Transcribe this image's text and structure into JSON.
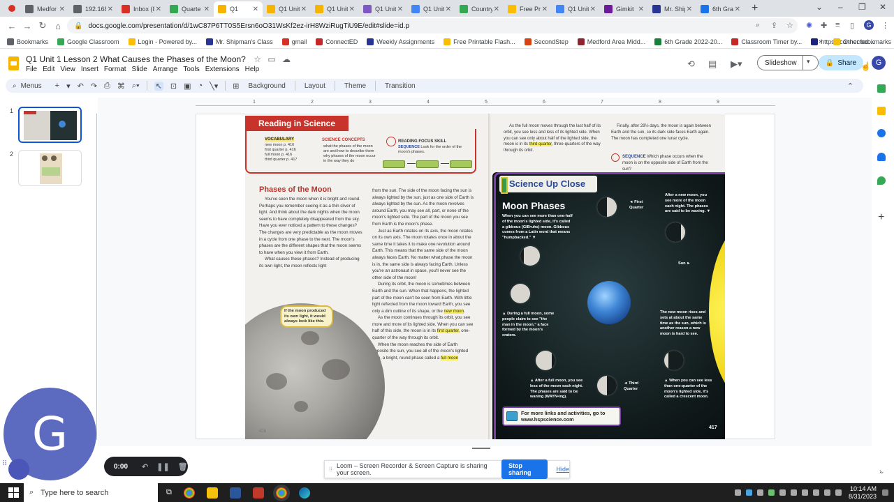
{
  "browser": {
    "tabs": [
      {
        "label": "Medfor",
        "color": "#5f6368"
      },
      {
        "label": "192.168",
        "color": "#5f6368"
      },
      {
        "label": "Inbox (8",
        "color": "#d93025"
      },
      {
        "label": "Quarte",
        "color": "#34a853"
      },
      {
        "label": "Q1",
        "color": "#f4b400",
        "active": true
      },
      {
        "label": "Q1 Unit",
        "color": "#f4b400"
      },
      {
        "label": "Q1 Unit",
        "color": "#f4b400"
      },
      {
        "label": "Q1 Unit",
        "color": "#7e57c2"
      },
      {
        "label": "Q1 Unit",
        "color": "#4285f4"
      },
      {
        "label": "Country",
        "color": "#34a853"
      },
      {
        "label": "Free Pri",
        "color": "#fbbc04"
      },
      {
        "label": "Q1 Unit",
        "color": "#4285f4"
      },
      {
        "label": "Gimkit",
        "color": "#6a1b9a"
      },
      {
        "label": "Mr. Ship",
        "color": "#283593"
      },
      {
        "label": "6th Gra",
        "color": "#1a73e8"
      }
    ],
    "url": "docs.google.com/presentation/d/1wC87P6TT0S5Ersn6oO31WsKf2ez-irH8WziRugTiU9E/edit#slide=id.p",
    "bookmarks": [
      {
        "label": "Bookmarks",
        "color": "#5f6368"
      },
      {
        "label": "Google Classroom",
        "color": "#34a853"
      },
      {
        "label": "Login - Powered by...",
        "color": "#fbbc04"
      },
      {
        "label": "Mr. Shipman's Class",
        "color": "#283593"
      },
      {
        "label": "gmail",
        "color": "#d93025"
      },
      {
        "label": "ConnectED",
        "color": "#c62828"
      },
      {
        "label": "Weekly Assignments",
        "color": "#283593"
      },
      {
        "label": "Free Printable Flash...",
        "color": "#fbbc04"
      },
      {
        "label": "SecondStep",
        "color": "#d84315"
      },
      {
        "label": "Medford Area Midd...",
        "color": "#8e2430"
      },
      {
        "label": "6th Grade 2022-20...",
        "color": "#188038"
      },
      {
        "label": "Classroom Timer by...",
        "color": "#c62828"
      },
      {
        "label": "https://connected....",
        "color": "#1a237e"
      }
    ],
    "other_bookmarks": "Other bookmarks"
  },
  "slides": {
    "title": "Q1 Unit 1 Lesson 2 What Causes the Phases of the Moon?",
    "menu": [
      "File",
      "Edit",
      "View",
      "Insert",
      "Format",
      "Slide",
      "Arrange",
      "Tools",
      "Extensions",
      "Help"
    ],
    "slideshow_label": "Slideshow",
    "share_label": "Share",
    "account_initial": "G",
    "toolbar": {
      "menus_label": "Menus",
      "background": "Background",
      "layout": "Layout",
      "theme": "Theme",
      "transition": "Transition"
    },
    "ruler_marks": [
      "1",
      "2",
      "3",
      "4",
      "5",
      "6",
      "7",
      "8",
      "9"
    ],
    "slide_numbers": [
      "1",
      "2"
    ]
  },
  "book": {
    "banner": "Reading in Science",
    "vocab_label": "VOCABULARY",
    "vocab_items": [
      "new moon p. 416",
      "first quarter p. 416",
      "full moon p. 416",
      "third quarter p. 417"
    ],
    "concepts_label": "SCIENCE CONCEPTS",
    "concepts": [
      "what the phases of the moon are and how to describe them",
      "why phases of the moon occur in the way they do"
    ],
    "focus_label": "READING FOCUS SKILL",
    "focus_skill": "SEQUENCE",
    "focus_text": "Look for the order of the moon's phases.",
    "phases_title": "Phases of the Moon",
    "col1a": "You've seen the moon when it is bright and round. Perhaps you remember seeing it as a thin sliver of light. And think about the dark nights when the moon seems to have completely disappeared from the sky. Have you ever noticed a pattern to these changes? The changes are very predictable as the moon moves in a cycle from one phase to the next. The moon's phases are the different shapes that the moon seems to have when you view it from Earth.",
    "col1b": "What causes these phases? Instead of producing its own light, the moon reflects light",
    "callout": "If the moon produced its own light, it would always look like this.",
    "col2a": "from the sun. The side of the moon facing the sun is always lighted by the sun, just as one side of Earth is always lighted by the sun. As the moon revolves around Earth, you may see all, part, or none of the moon's lighted side. The part of the moon you see from Earth is the moon's phase.",
    "col2b": "Just as Earth rotates on its axis, the moon rotates on its own axis. The moon rotates once in about the same time it takes it to make one revolution around Earth. This means that the same side of the moon always faces Earth. No matter what phase the moon is in, the same side is always facing Earth. Unless you're an astronaut in space, you'll never see the other side of the moon!",
    "col2c": "During its orbit, the moon is sometimes between Earth and the sun. When that happens, the lighted part of the moon can't be seen from Earth. With little light reflected from the moon toward Earth, you see only a dim outline of its shape, or the",
    "hl_new_moon": "new moon",
    "col2d": "As the moon continues through its orbit, you see more and more of its lighted side. When you can see half of this side, the moon is in its",
    "hl_first_quarter": "first quarter",
    "col2e": ", one-quarter of the way through its orbit.",
    "col2f": "When the moon reaches the side of Earth opposite the sun, you see all of the moon's lighted side, a bright, round phase called a",
    "hl_full_moon": "full moon",
    "page_left": "416",
    "right_col1": "As the full moon moves through the last half of its orbit, you see less and less of its lighted side. When you can see only about half of the lighted side, the moon is in its",
    "hl_third_quarter": "third quarter",
    "right_col1b": ", three-quarters of the way through its orbit.",
    "right_col2": "Finally, after 29½ days, the moon is again between Earth and the sun, so its dark side faces Earth again. The moon has completed one lunar cycle.",
    "seq_label": "SEQUENCE",
    "seq_question": "Which phase occurs when the moon is on the opposite side of Earth from the sun?",
    "suc_banner": "Science Up Close",
    "moon_phases_title": "Moon Phases",
    "gibbous_text": "When you can see more than one-half of the moon's lighted side, it's called a gibbous (GIB•uhs) moon. Gibbous comes from a Latin word that means \"humpbacked.\" ▼",
    "first_quarter_label": "◄ First Quarter",
    "waxing_text": "After a new moon, you see more of the moon each night. The phases are said to be waxing. ▼",
    "sun_label": "Sun ►",
    "full_moon_text": "▲ During a full moon, some people claim to see \"the man in the moon,\" a face formed by the moon's craters.",
    "new_moon_text": "The new moon rises and sets at about the same time as the sun, which is another reason a new moon is hard to see.",
    "waning_text": "▲ After a full moon, you see less of the moon each night. The phases are said to be waning (WAYN•ing).",
    "third_quarter_label": "◄ Third Quarter",
    "crescent_text": "▲ When you can see less than one-quarter of the moon's lighted side, it's called a crescent moon.",
    "links_text": "For more links and activities, go to www.hspscience.com",
    "page_right": "417"
  },
  "loom": {
    "avatar_initial": "G",
    "timer": "0:00",
    "sharing_msg": "Loom – Screen Recorder & Screen Capture is sharing your screen.",
    "stop_label": "Stop sharing",
    "hide_label": "Hide"
  },
  "taskbar": {
    "search_placeholder": "Type here to search",
    "time": "10:14 AM",
    "date": "8/31/2023"
  }
}
